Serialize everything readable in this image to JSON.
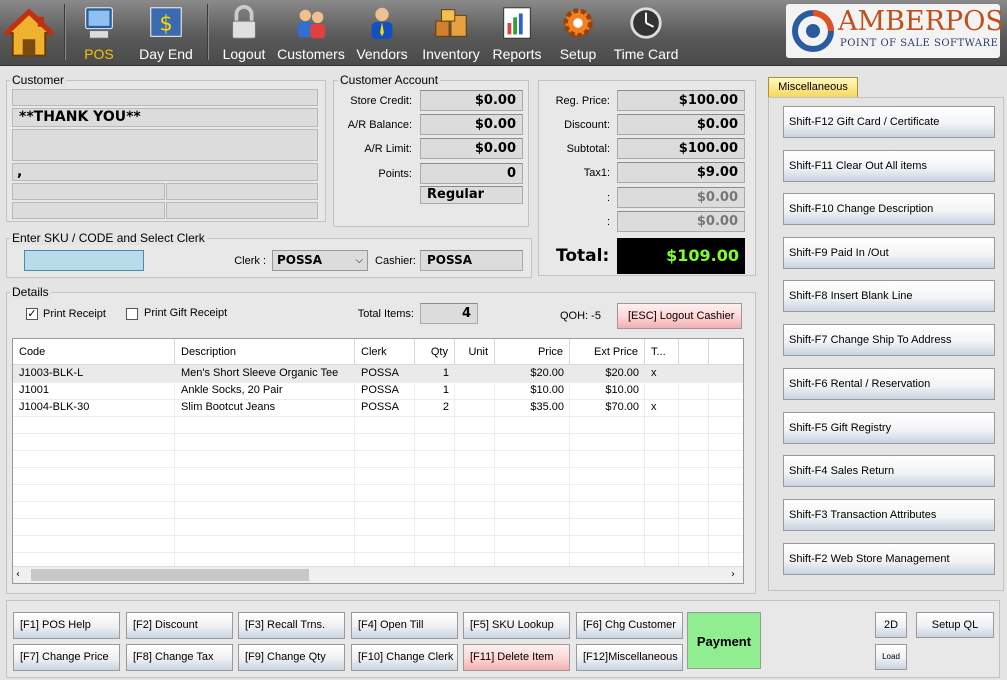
{
  "toolbar": {
    "items": [
      {
        "label": "POS"
      },
      {
        "label": "Day End"
      },
      {
        "label": "Logout"
      },
      {
        "label": "Customers"
      },
      {
        "label": "Vendors"
      },
      {
        "label": "Inventory"
      },
      {
        "label": "Reports"
      },
      {
        "label": "Setup"
      },
      {
        "label": "Time Card"
      }
    ],
    "logo_title": "AMBERPOS",
    "logo_subtitle": "POINT OF SALE SOFTWARE"
  },
  "customer": {
    "group_title": "Customer",
    "line2": "**THANK YOU**",
    "line4": ","
  },
  "account": {
    "group_title": "Customer Account",
    "store_credit_label": "Store Credit:",
    "store_credit": "$0.00",
    "ar_balance_label": "A/R Balance:",
    "ar_balance": "$0.00",
    "ar_limit_label": "A/R Limit:",
    "ar_limit": "$0.00",
    "points_label": "Points:",
    "points": "0",
    "price_level": "Regular"
  },
  "totals": {
    "reg_price_label": "Reg. Price:",
    "reg_price": "$100.00",
    "discount_label": "Discount:",
    "discount": "$0.00",
    "subtotal_label": "Subtotal:",
    "subtotal": "$100.00",
    "tax1_label": "Tax1:",
    "tax1": "$9.00",
    "extra1_label": ":",
    "extra1": "$0.00",
    "extra2_label": ":",
    "extra2": "$0.00",
    "total_label": "Total:",
    "total": "$109.00",
    "total_color": "#7dff2a"
  },
  "entry": {
    "group_title": "Enter SKU / CODE and Select Clerk",
    "sku_value": "",
    "clerk_label": "Clerk :",
    "clerk_value": "POSSA",
    "cashier_label": "Cashier:",
    "cashier_value": "POSSA"
  },
  "details": {
    "group_title": "Details",
    "print_receipt": "Print Receipt",
    "print_receipt_checked": true,
    "print_gift_receipt": "Print Gift Receipt",
    "print_gift_receipt_checked": false,
    "total_items_label": "Total Items:",
    "total_items": "4",
    "qoh": "QOH: -5",
    "logout_cashier": "[ESC] Logout Cashier"
  },
  "table": {
    "columns": [
      "Code",
      "Description",
      "Clerk",
      "Qty",
      "Unit",
      "Price",
      "Ext Price",
      "T..."
    ],
    "rows": [
      [
        "J1003-BLK-L",
        "Men's Short Sleeve Organic Tee",
        "POSSA",
        "1",
        "",
        "$20.00",
        "$20.00",
        "x"
      ],
      [
        "J1001",
        "Ankle Socks, 20 Pair",
        "POSSA",
        "1",
        "",
        "$10.00",
        "$10.00",
        ""
      ],
      [
        "J1004-BLK-30",
        "Slim Bootcut Jeans",
        "POSSA",
        "2",
        "",
        "$35.00",
        "$70.00",
        "x"
      ]
    ]
  },
  "misc": {
    "tab_label": "Miscellaneous",
    "buttons": [
      "Shift-F12  Gift Card / Certificate",
      "Shift-F11 Clear Out All items",
      "Shift-F10  Change Description",
      "Shift-F9   Paid In /Out",
      "Shift-F8   Insert Blank Line",
      "Shift-F7   Change Ship To Address",
      "Shift-F6 Rental / Reservation",
      "Shift-F5  Gift Registry",
      "Shift-F4  Sales Return",
      "Shift-F3  Transaction Attributes",
      "Shift-F2 Web Store Management"
    ]
  },
  "fkeys": {
    "row1": [
      "[F1] POS Help",
      "[F2] Discount",
      "[F3] Recall Trns.",
      "[F4] Open Till",
      "[F5] SKU Lookup",
      "[F6] Chg Customer"
    ],
    "row2": [
      "[F7] Change Price",
      "[F8] Change Tax",
      "[F9] Change Qty",
      "[F10] Change Clerk",
      "[F11] Delete Item",
      "[F12]Miscellaneous"
    ],
    "payment": "Payment",
    "btn_2d": "2D",
    "setup_ql": "Setup QL",
    "load": "Load"
  }
}
